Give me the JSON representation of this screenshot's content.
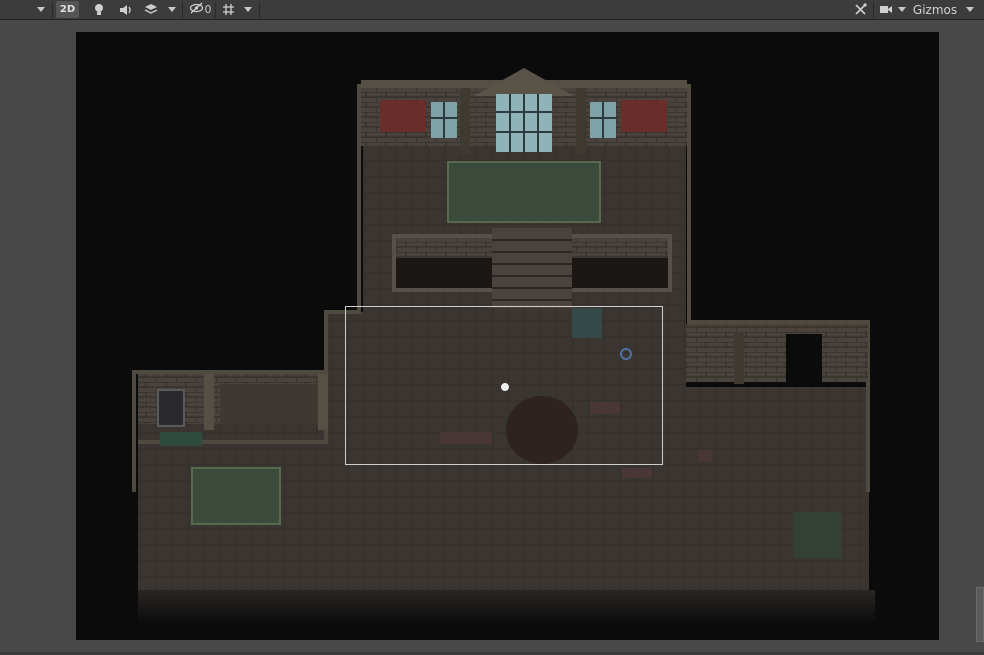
{
  "toolbar": {
    "mode_label": "2D",
    "hidden_count": "0",
    "gizmos_label": "Gizmos"
  },
  "icons": {
    "lighting": "lightbulb-icon",
    "audio": "speaker-icon",
    "effects": "layers-icon",
    "visibility": "eye-slash-icon",
    "grid": "grid-icon",
    "tools": "wrench-icon",
    "camera": "camera-icon"
  },
  "colors": {
    "toolbar_bg": "#3c3c3c",
    "scene_bg": "#484848",
    "camera_frame": "#0b0b0b",
    "floor": "#3a3531",
    "wall": "#4a423c",
    "carpet": "#3b4a3a",
    "camera_bounds": "#cfcfcf"
  }
}
